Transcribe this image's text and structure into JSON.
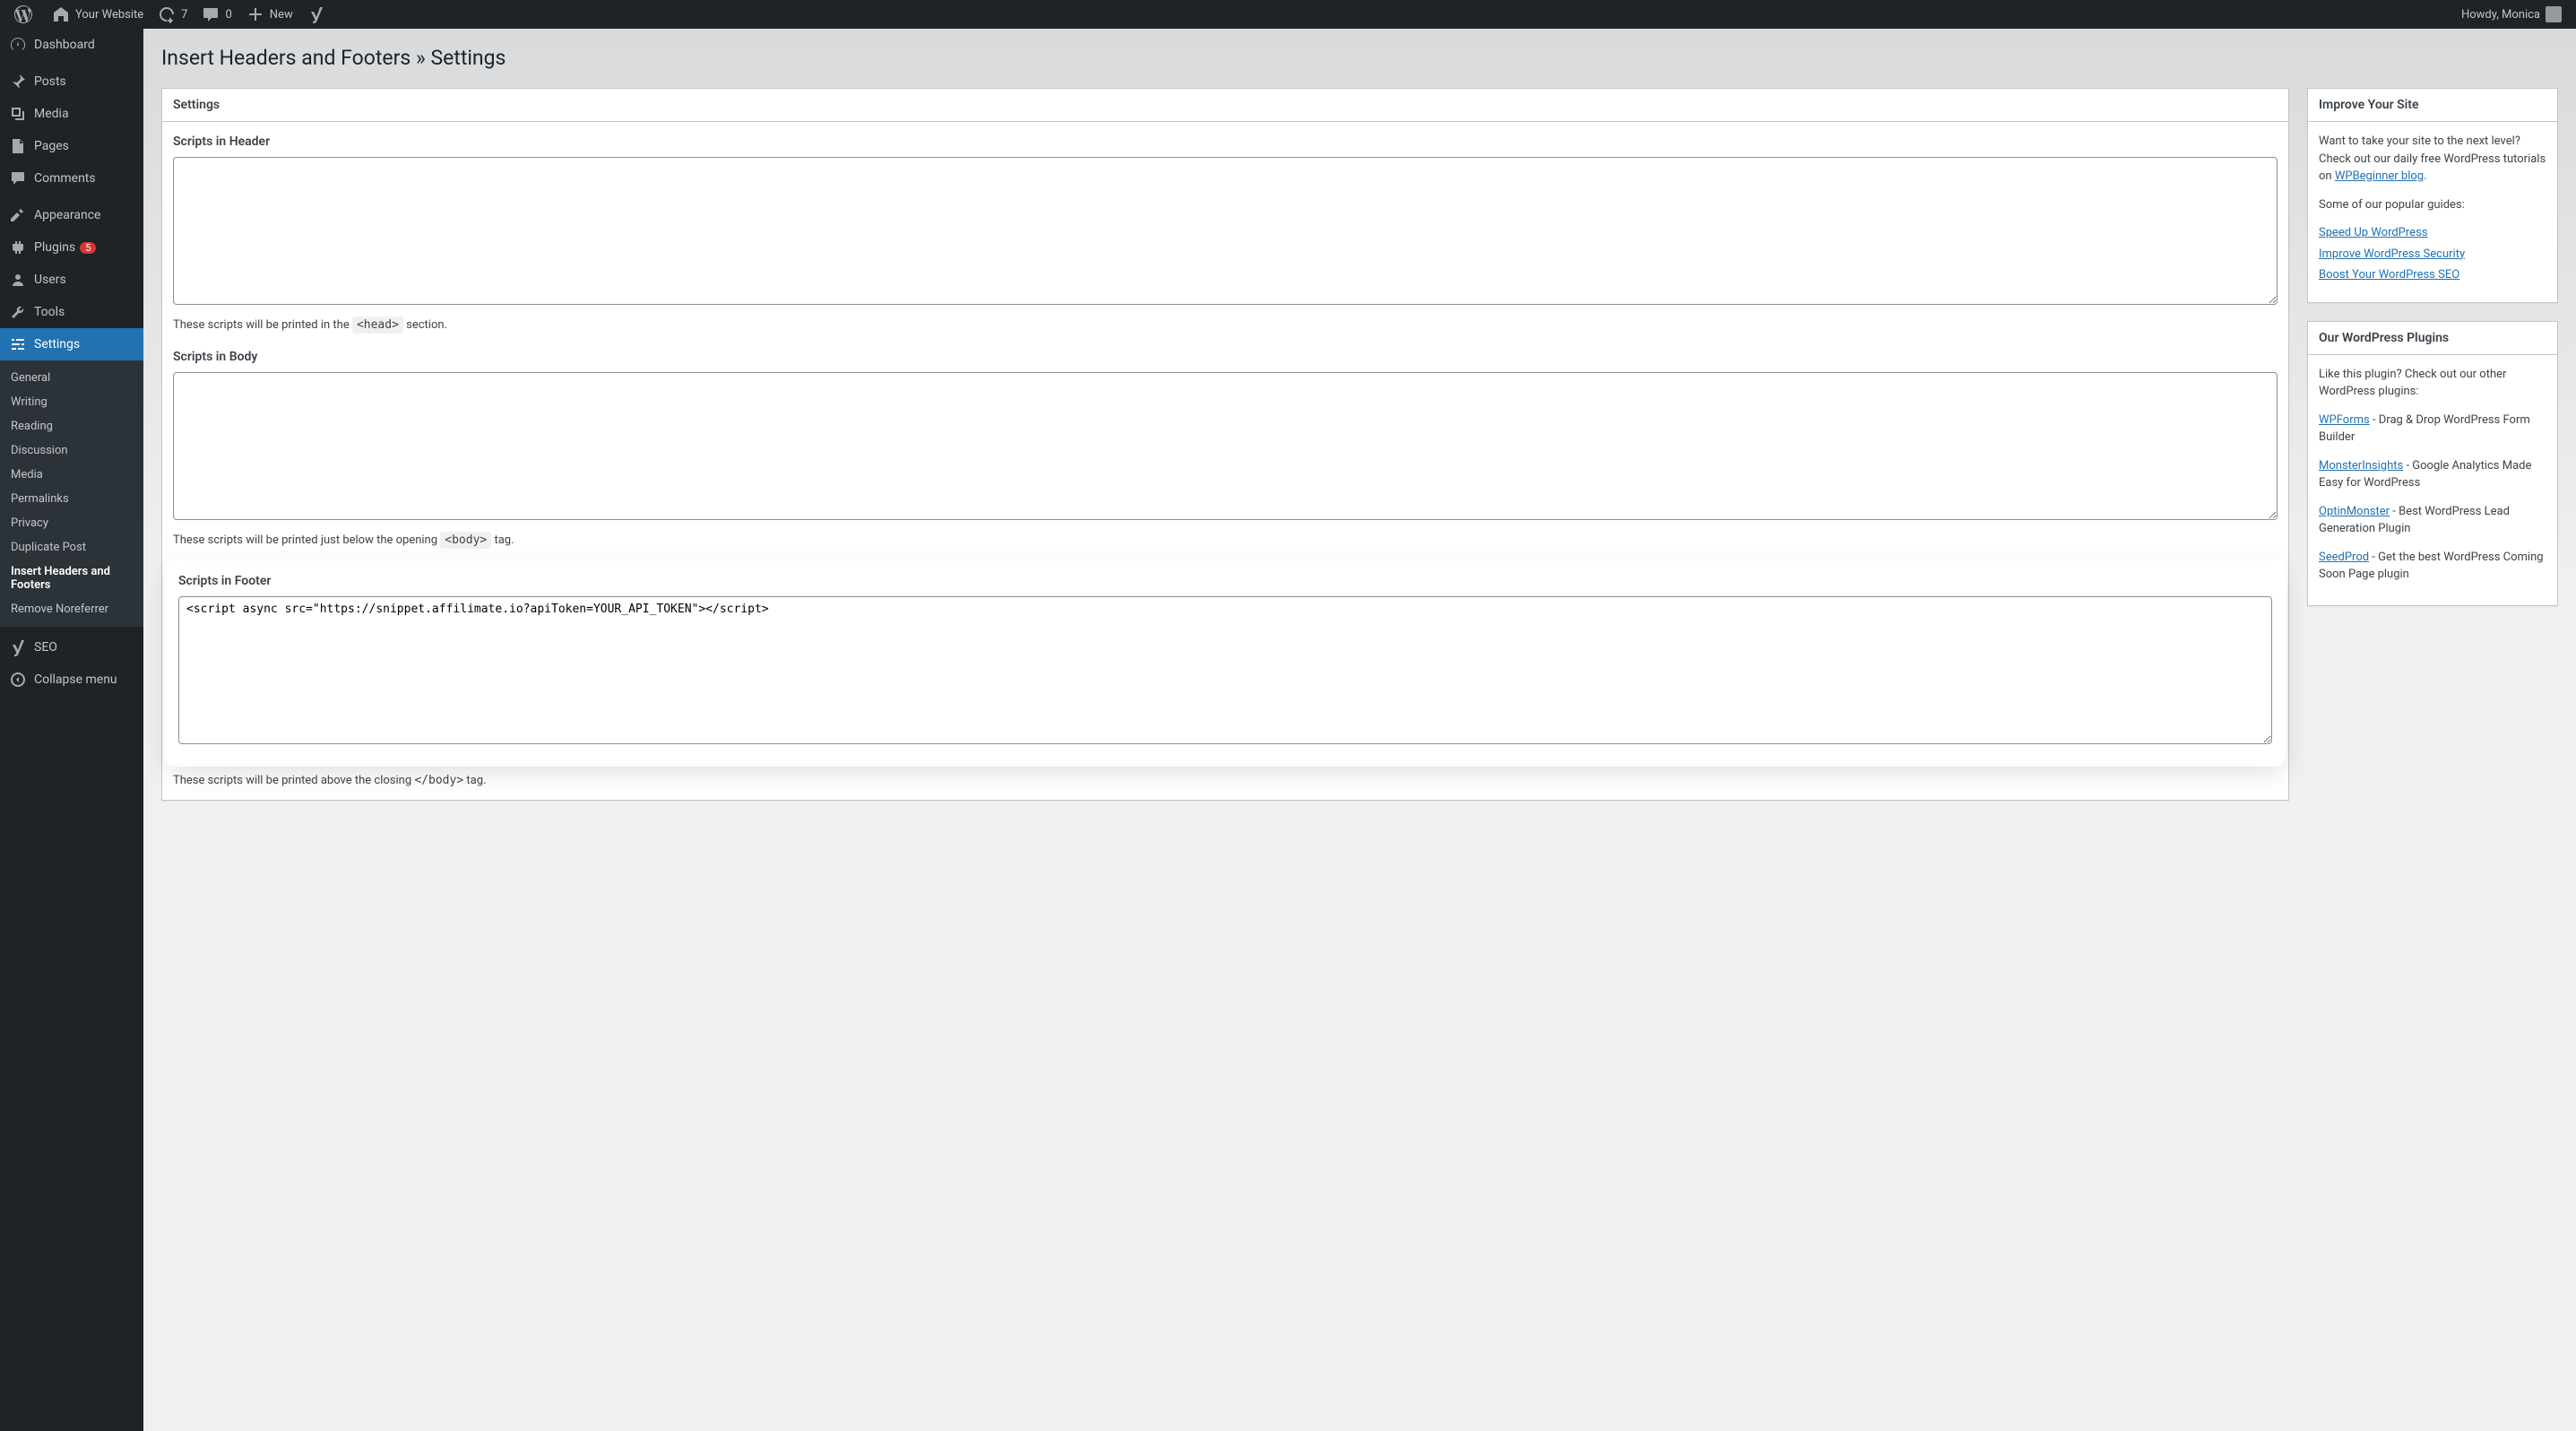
{
  "adminbar": {
    "site_name": "Your Website",
    "updates": "7",
    "comments": "0",
    "new_label": "New",
    "howdy": "Howdy, Monica"
  },
  "sidebar": {
    "items": [
      {
        "label": "Dashboard",
        "icon": "dashboard"
      },
      {
        "label": "Posts",
        "icon": "posts"
      },
      {
        "label": "Media",
        "icon": "media"
      },
      {
        "label": "Pages",
        "icon": "pages"
      },
      {
        "label": "Comments",
        "icon": "comments"
      },
      {
        "label": "Appearance",
        "icon": "appearance"
      },
      {
        "label": "Plugins",
        "icon": "plugins",
        "badge": "5"
      },
      {
        "label": "Users",
        "icon": "users"
      },
      {
        "label": "Tools",
        "icon": "tools"
      },
      {
        "label": "Settings",
        "icon": "settings",
        "current": true
      },
      {
        "label": "SEO",
        "icon": "seo"
      },
      {
        "label": "Collapse menu",
        "icon": "collapse"
      }
    ],
    "submenu": [
      {
        "label": "General"
      },
      {
        "label": "Writing"
      },
      {
        "label": "Reading"
      },
      {
        "label": "Discussion"
      },
      {
        "label": "Media"
      },
      {
        "label": "Permalinks"
      },
      {
        "label": "Privacy"
      },
      {
        "label": "Duplicate Post"
      },
      {
        "label": "Insert Headers and Footers",
        "current": true
      },
      {
        "label": "Remove Noreferrer"
      }
    ]
  },
  "page": {
    "title": "Insert Headers and Footers » Settings",
    "settings_heading": "Settings",
    "fields": {
      "header": {
        "label": "Scripts in Header",
        "value": "",
        "desc_pre": "These scripts will be printed in the ",
        "desc_code": "<head>",
        "desc_post": " section."
      },
      "body": {
        "label": "Scripts in Body",
        "value": "",
        "desc_pre": "These scripts will be printed just below the opening ",
        "desc_code": "<body>",
        "desc_post": " tag."
      },
      "footer": {
        "label": "Scripts in Footer",
        "value": "<script async src=\"https://snippet.affilimate.io?apiToken=YOUR_API_TOKEN\"></script>",
        "desc_pre": "These scripts will be printed above the closing ",
        "desc_code": "</body>",
        "desc_post": " tag."
      }
    }
  },
  "side": {
    "improve": {
      "heading": "Improve Your Site",
      "intro_pre": "Want to take your site to the next level? Check out our daily free WordPress tutorials on ",
      "intro_link": "WPBeginner blog",
      "intro_post": ".",
      "popular": "Some of our popular guides:",
      "links": [
        "Speed Up WordPress",
        "Improve WordPress Security",
        "Boost Your WordPress SEO"
      ]
    },
    "plugins": {
      "heading": "Our WordPress Plugins",
      "intro": "Like this plugin? Check out our other WordPress plugins:",
      "items": [
        {
          "name": "WPForms",
          "desc": " - Drag & Drop WordPress Form Builder"
        },
        {
          "name": "MonsterInsights",
          "desc": " - Google Analytics Made Easy for WordPress"
        },
        {
          "name": "OptinMonster",
          "desc": " - Best WordPress Lead Generation Plugin"
        },
        {
          "name": "SeedProd",
          "desc": " - Get the best WordPress Coming Soon Page plugin"
        }
      ]
    }
  }
}
